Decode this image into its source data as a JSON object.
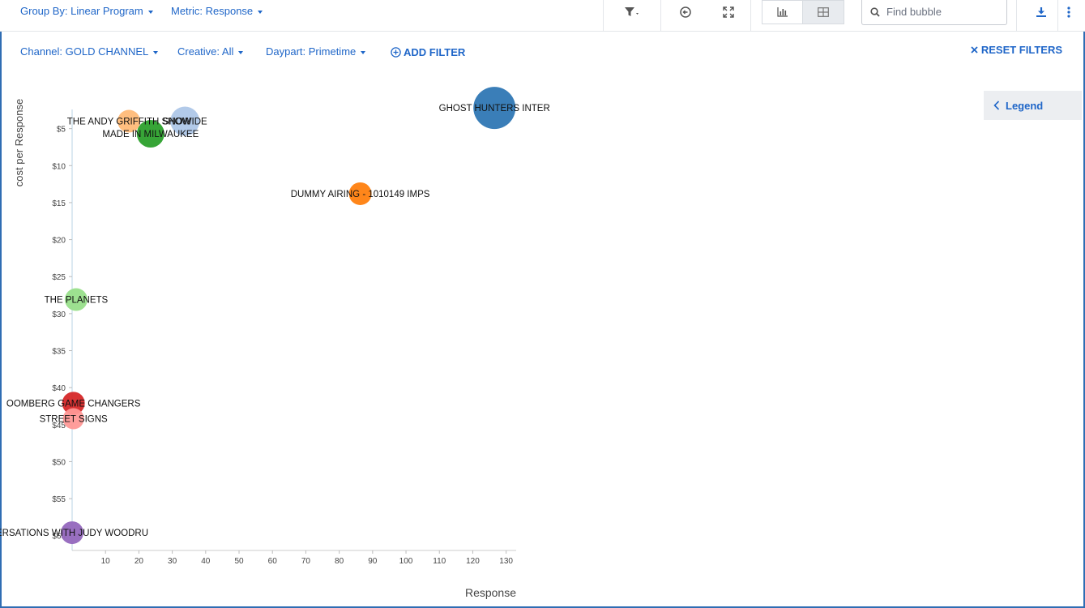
{
  "header": {
    "group_by": "Group By: Linear Program",
    "metric": "Metric: Response",
    "search_placeholder": "Find bubble"
  },
  "filters": {
    "channel": "Channel: GOLD CHANNEL",
    "creative": "Creative: All",
    "daypart": "Daypart: Primetime",
    "add_filter": "ADD FILTER",
    "reset_filters": "RESET FILTERS"
  },
  "legend_tab": {
    "label": "Legend"
  },
  "icons": {
    "filter": "filter-icon",
    "reset_zoom": "reset-zoom-icon",
    "expand": "expand-icon",
    "chart_view": "bar-chart-icon",
    "table_view": "table-icon",
    "search": "search-icon",
    "download": "download-icon",
    "more": "more-vertical-icon",
    "legend": "chevron-left-icon"
  },
  "colors": {
    "accent": "#1f66c8",
    "axis": "#b9d3e6"
  },
  "chart_data": {
    "type": "scatter",
    "xlabel": "Response",
    "ylabel": "cost per Response",
    "xlim": [
      0,
      133
    ],
    "ylim": [
      0,
      62
    ],
    "y_inverted": true,
    "x_ticks": [
      10,
      20,
      30,
      40,
      50,
      60,
      70,
      80,
      90,
      100,
      110,
      120,
      130
    ],
    "y_ticks": [
      5,
      10,
      15,
      20,
      25,
      30,
      35,
      40,
      45,
      50,
      55,
      60
    ],
    "y_tick_labels": [
      "$5",
      "$10",
      "$15",
      "$20",
      "$25",
      "$30",
      "$35",
      "$40",
      "$45",
      "$50",
      "$55",
      "$60"
    ],
    "points": [
      {
        "label": "GHOST HUNTERS INTER",
        "x": 126.5,
        "y": 2.2,
        "size": 26,
        "color": "#2f77b4"
      },
      {
        "label": "SNOWIDE",
        "x": 33.8,
        "y": 4.0,
        "size": 18,
        "color": "#aec7e8"
      },
      {
        "label": "THE ANDY GRIFFITH SHOW",
        "x": 17,
        "y": 4.0,
        "size": 14,
        "color": "#ffbb78"
      },
      {
        "label": "MADE IN MILWAUKEE",
        "x": 23.5,
        "y": 5.7,
        "size": 17,
        "color": "#2ca02c"
      },
      {
        "label": "DUMMY AIRING - 1010149 IMPS",
        "x": 86.3,
        "y": 13.8,
        "size": 14,
        "color": "#ff7f0e"
      },
      {
        "label": "THE PLANETS",
        "x": 1.2,
        "y": 28.1,
        "size": 14,
        "color": "#98df8a"
      },
      {
        "label": "OOMBERG GAME CHANGERS",
        "x": 0.4,
        "y": 42.1,
        "size": 14,
        "color": "#d62728"
      },
      {
        "label": "STREET SIGNS",
        "x": 0.4,
        "y": 44.2,
        "size": 13,
        "color": "#ff9896"
      },
      {
        "label": "ERSATIONS WITH JUDY WOODRU",
        "x": 0.0,
        "y": 59.6,
        "size": 14,
        "color": "#9467bd"
      }
    ]
  }
}
